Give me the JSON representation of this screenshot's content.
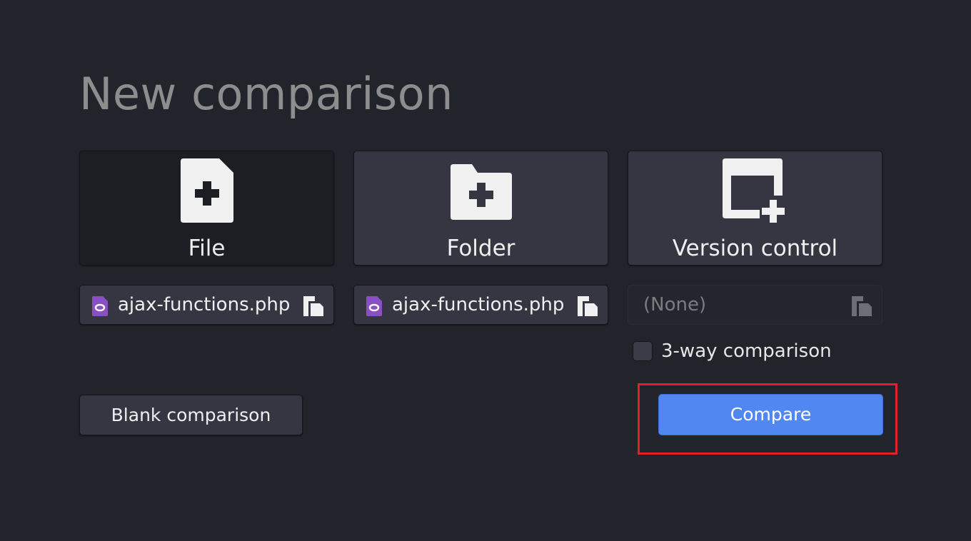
{
  "title": "New comparison",
  "modes": {
    "file": {
      "label": "File",
      "icon": "file-add-icon",
      "selected": true
    },
    "folder": {
      "label": "Folder",
      "icon": "folder-add-icon",
      "selected": false
    },
    "vc": {
      "label": "Version control",
      "icon": "version-control-add-icon",
      "selected": false
    }
  },
  "choosers": {
    "first": {
      "filename": "ajax-functions.php",
      "file_icon": "php-file-icon",
      "browse_icon": "browse-icon"
    },
    "second": {
      "filename": "ajax-functions.php",
      "file_icon": "php-file-icon",
      "browse_icon": "browse-icon"
    },
    "third": {
      "filename": "(None)",
      "browse_icon": "browse-icon",
      "disabled": true
    }
  },
  "three_way": {
    "label": "3-way comparison",
    "checked": false
  },
  "buttons": {
    "blank": "Blank comparison",
    "compare": "Compare"
  },
  "colors": {
    "background": "#22242b",
    "button": "#353641",
    "accent": "#5187f0",
    "php_icon": "#8b4fc4",
    "highlight": "#e0202b"
  }
}
